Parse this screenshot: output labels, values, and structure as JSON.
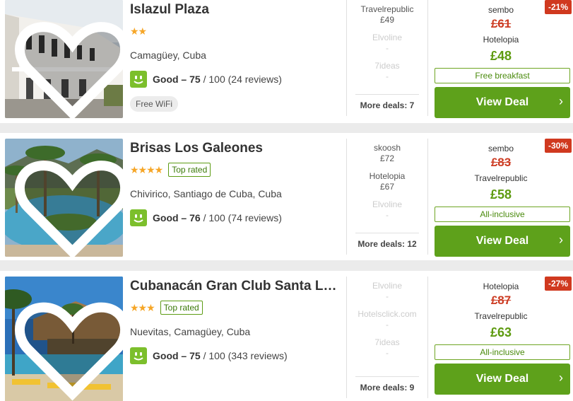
{
  "hotels": [
    {
      "name": "Islazul Plaza",
      "stars": "★★",
      "top_rated": "",
      "location": "Camagüey, Cuba",
      "rating_word": "Good",
      "rating_score": "75",
      "rating_out_of": "/ 100",
      "reviews": "(24 reviews)",
      "amenity": "Free WiFi",
      "deals": [
        {
          "provider": "Travelrepublic",
          "price": "£49",
          "muted": false
        },
        {
          "provider": "Elvoline",
          "price": "-",
          "muted": true
        },
        {
          "provider": "7ideas",
          "price": "-",
          "muted": true
        }
      ],
      "more_deals": "More deals: 7",
      "discount": "-21%",
      "old_provider": "sembo",
      "old_price": "£61",
      "new_provider": "Hotelopia",
      "new_price": "£48",
      "perk": "Free breakfast",
      "cta": "View Deal"
    },
    {
      "name": "Brisas Los Galeones",
      "stars": "★★★★",
      "top_rated": "Top rated",
      "location": "Chivirico, Santiago de Cuba, Cuba",
      "rating_word": "Good",
      "rating_score": "76",
      "rating_out_of": "/ 100",
      "reviews": "(74 reviews)",
      "amenity": "",
      "deals": [
        {
          "provider": "skoosh",
          "price": "£72",
          "muted": false
        },
        {
          "provider": "Hotelopia",
          "price": "£67",
          "muted": false
        },
        {
          "provider": "Elvoline",
          "price": "-",
          "muted": true
        }
      ],
      "more_deals": "More deals: 12",
      "discount": "-30%",
      "old_provider": "sembo",
      "old_price": "£83",
      "new_provider": "Travelrepublic",
      "new_price": "£58",
      "perk": "All-inclusive",
      "cta": "View Deal"
    },
    {
      "name": "Cubanacán Gran Club Santa Lucía",
      "stars": "★★★",
      "top_rated": "Top rated",
      "location": "Nuevitas, Camagüey, Cuba",
      "rating_word": "Good",
      "rating_score": "75",
      "rating_out_of": "/ 100",
      "reviews": "(343 reviews)",
      "amenity": "",
      "deals": [
        {
          "provider": "Elvoline",
          "price": "-",
          "muted": true
        },
        {
          "provider": "Hotelsclick.com",
          "price": "-",
          "muted": true
        },
        {
          "provider": "7ideas",
          "price": "-",
          "muted": true
        }
      ],
      "more_deals": "More deals: 9",
      "discount": "-27%",
      "old_provider": "Hotelopia",
      "old_price": "£87",
      "new_provider": "Travelrepublic",
      "new_price": "£63",
      "perk": "All-inclusive",
      "cta": "View Deal"
    }
  ],
  "icons": {
    "favorite": "heart-icon",
    "rating": "smiley-icon",
    "cta": "chevron-right-icon"
  },
  "colors": {
    "accent_green": "#5ea11b",
    "discount_red": "#d0391f",
    "star_orange": "#f6a627"
  }
}
